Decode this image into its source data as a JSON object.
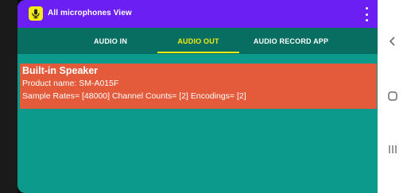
{
  "app": {
    "title": "All microphones View",
    "icon": "microphone-icon",
    "menu_icon": "overflow-menu-icon"
  },
  "tabs": [
    {
      "label": "AUDIO IN",
      "active": false
    },
    {
      "label": "AUDIO OUT",
      "active": true
    },
    {
      "label": "AUDIO RECORD APP",
      "active": false
    }
  ],
  "device": {
    "name": "Built-in Speaker",
    "product": "Product name: SM-A015F",
    "details": "Sample Rates= [48000]  Channel Counts= [2]  Encodings= [2]"
  },
  "navigation": {
    "back_icon": "back-chevron-icon",
    "home_icon": "home-icon",
    "recents_icon": "recents-icon"
  },
  "colors": {
    "appbar": "#6c1ff3",
    "tabbar": "#086e62",
    "background": "#0c9a8c",
    "card": "#e35b3a",
    "accent": "#f4eb12"
  }
}
